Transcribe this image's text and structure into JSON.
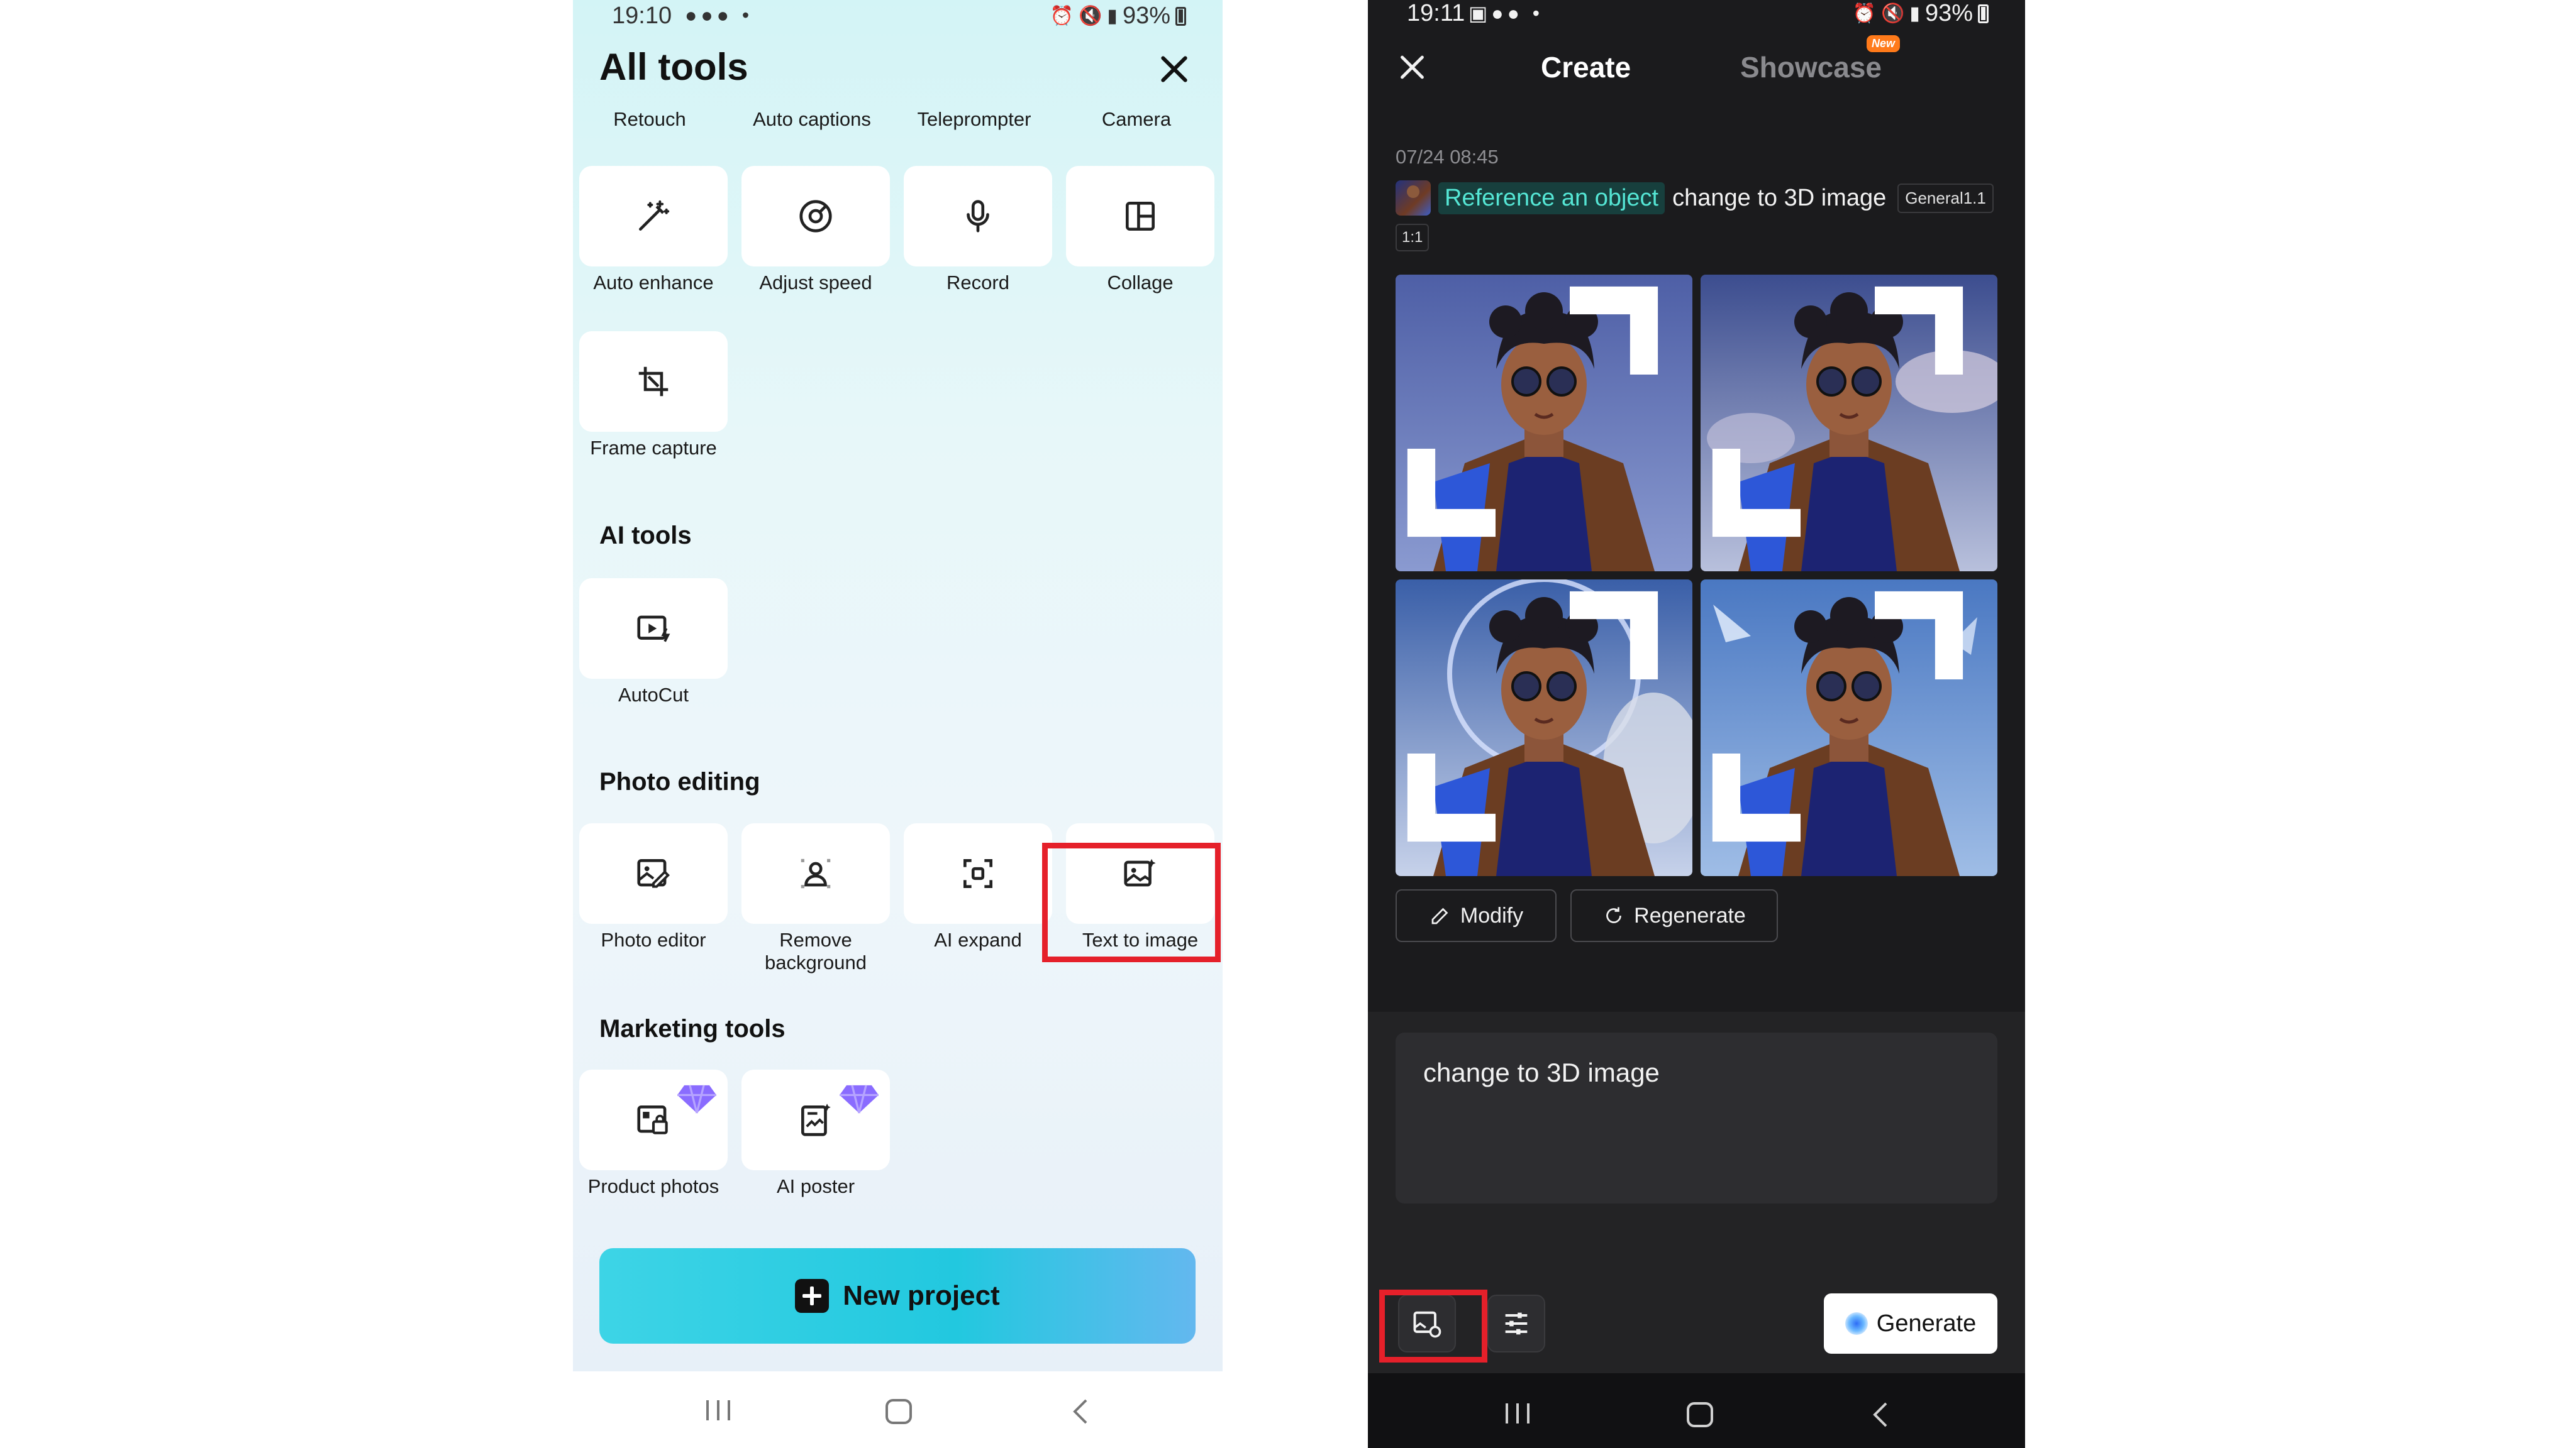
{
  "left_screen": {
    "status_bar": {
      "time": "19:10",
      "battery": "93%"
    },
    "title": "All tools",
    "top_row_labels": [
      "Retouch",
      "Auto captions",
      "Teleprompter",
      "Camera"
    ],
    "tools": [
      {
        "label": "Auto enhance",
        "icon": "magic-wand-icon"
      },
      {
        "label": "Adjust speed",
        "icon": "speedometer-icon"
      },
      {
        "label": "Record",
        "icon": "microphone-icon"
      },
      {
        "label": "Collage",
        "icon": "collage-icon"
      },
      {
        "label": "Frame capture",
        "icon": "crop-frame-icon"
      }
    ],
    "ai_tools": {
      "title": "AI tools",
      "items": [
        {
          "label": "AutoCut",
          "icon": "autocut-icon"
        }
      ]
    },
    "photo_editing": {
      "title": "Photo editing",
      "items": [
        {
          "label": "Photo editor",
          "icon": "photo-edit-icon"
        },
        {
          "label": "Remove background",
          "icon": "remove-background-icon"
        },
        {
          "label": "AI expand",
          "icon": "expand-focus-icon"
        },
        {
          "label": "Text to image",
          "icon": "image-sparkle-icon"
        }
      ]
    },
    "marketing_tools": {
      "title": "Marketing tools",
      "items": [
        {
          "label": "Product photos",
          "icon": "product-photo-icon",
          "premium": true
        },
        {
          "label": "AI poster",
          "icon": "poster-icon",
          "premium": true
        }
      ]
    },
    "new_project_label": "New project",
    "highlight_color": "#e5202a"
  },
  "right_screen": {
    "status_bar": {
      "time": "19:11",
      "battery": "93%"
    },
    "tabs": {
      "active": "Create",
      "inactive": "Showcase",
      "badge": "New"
    },
    "timestamp": "07/24 08:45",
    "reference_chip": "Reference an object",
    "prompt": "change to 3D image",
    "model": "General1.1",
    "ratio": "1:1",
    "buttons": {
      "modify": "Modify",
      "regenerate": "Regenerate",
      "generate": "Generate"
    },
    "input_text": "change to 3D image",
    "accent_color": "#55e6d5"
  }
}
